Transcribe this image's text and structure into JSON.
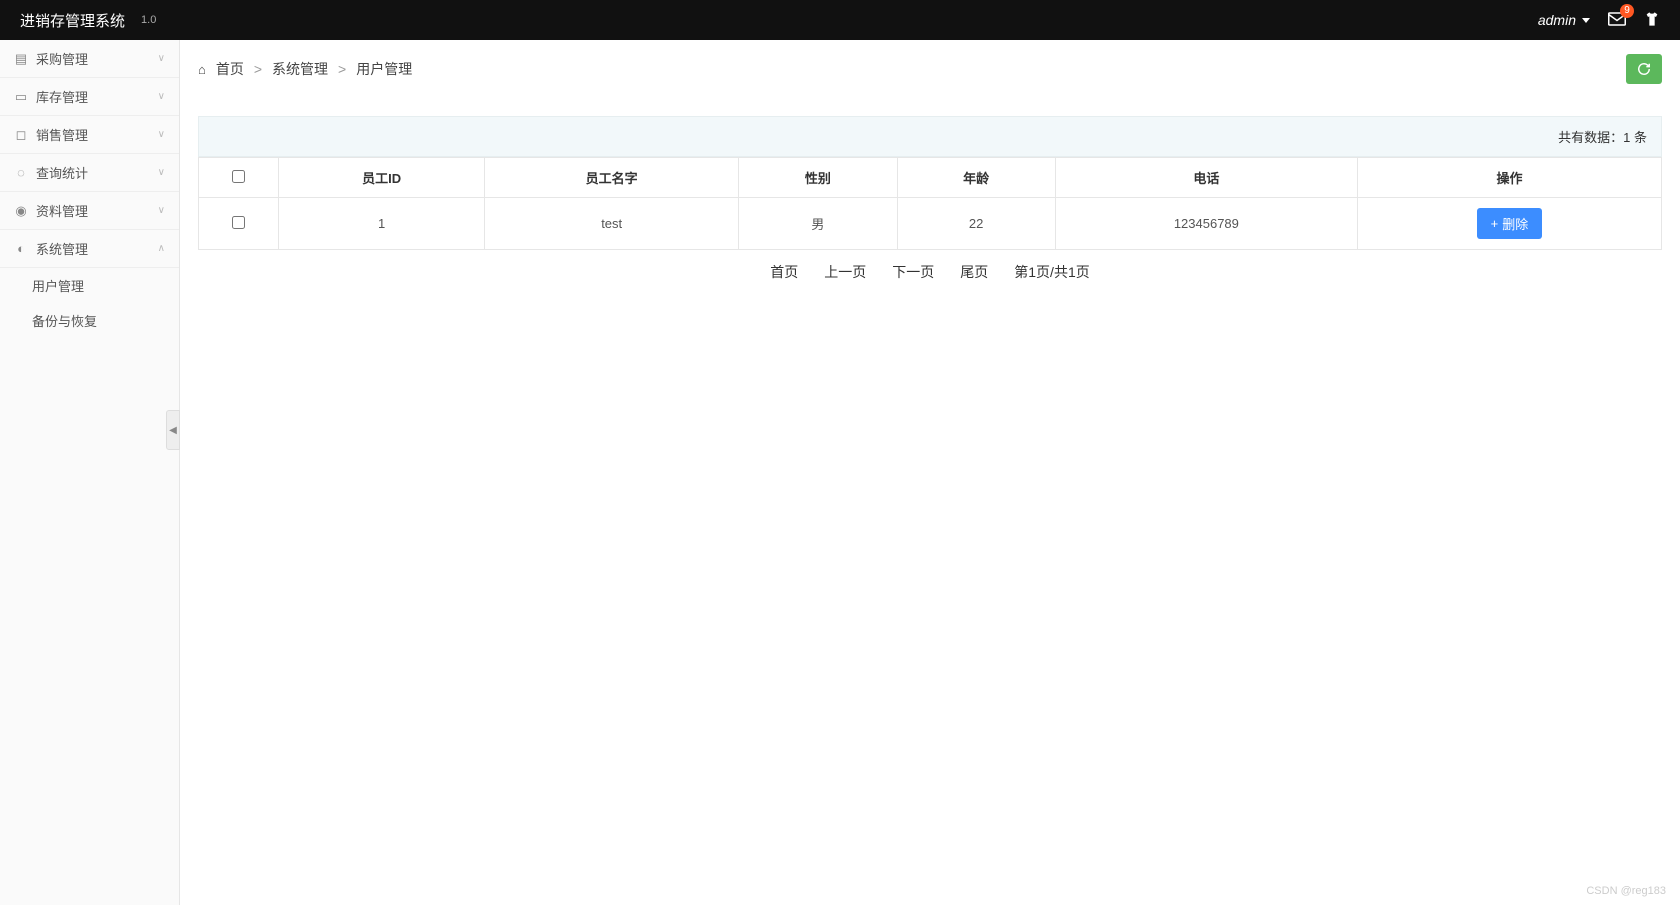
{
  "header": {
    "title": "进销存管理系统",
    "version": "1.0",
    "user": "admin",
    "badge_count": "9"
  },
  "sidebar": {
    "items": [
      {
        "label": "采购管理",
        "expanded": false
      },
      {
        "label": "库存管理",
        "expanded": false
      },
      {
        "label": "销售管理",
        "expanded": false
      },
      {
        "label": "查询统计",
        "expanded": false
      },
      {
        "label": "资料管理",
        "expanded": false
      },
      {
        "label": "系统管理",
        "expanded": true
      }
    ],
    "submenu": [
      {
        "label": "用户管理"
      },
      {
        "label": "备份与恢复"
      }
    ]
  },
  "breadcrumb": {
    "home": "首页",
    "level1": "系统管理",
    "level2": "用户管理"
  },
  "info_bar": {
    "prefix": "共有数据：",
    "count": "1",
    "suffix": " 条"
  },
  "table": {
    "headers": {
      "id": "员工ID",
      "name": "员工名字",
      "gender": "性别",
      "age": "年龄",
      "phone": "电话",
      "action": "操作"
    },
    "rows": [
      {
        "id": "1",
        "name": "test",
        "gender": "男",
        "age": "22",
        "phone": "123456789"
      }
    ],
    "delete_label": "删除"
  },
  "pagination": {
    "first": "首页",
    "prev": "上一页",
    "next": "下一页",
    "last": "尾页",
    "info": "第1页/共1页"
  },
  "watermark": "CSDN @reg183"
}
